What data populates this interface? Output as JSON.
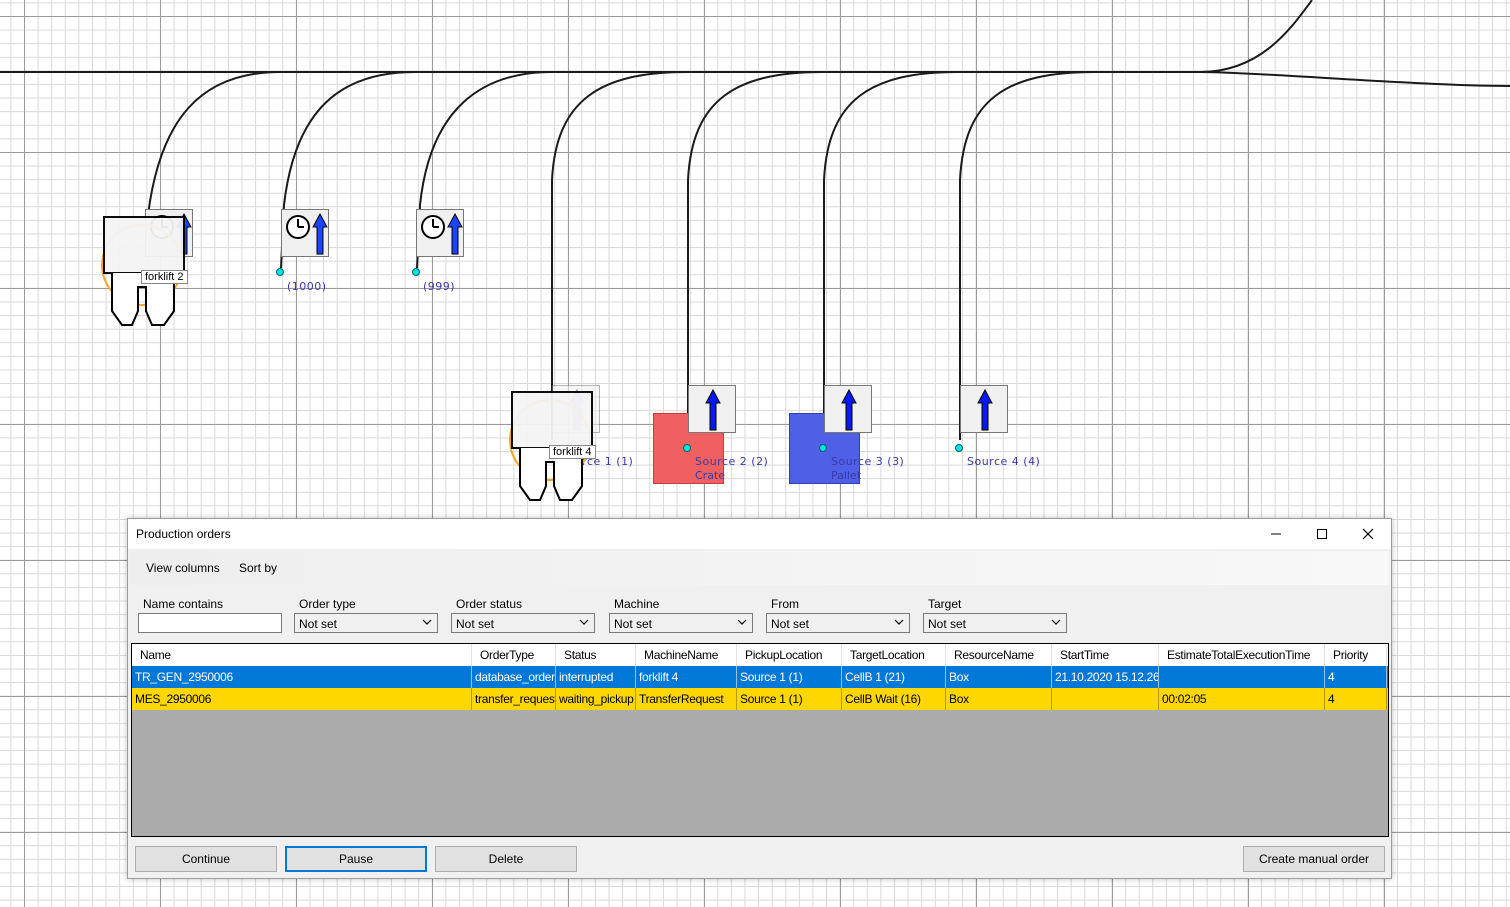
{
  "canvas": {
    "stations": [
      {
        "id": "s-clock-1",
        "has_clock": true
      },
      {
        "id": "s-clock-2",
        "has_clock": true,
        "label": "(1000)"
      },
      {
        "id": "s-clock-3",
        "has_clock": true,
        "label": "(999)"
      },
      {
        "id": "source-1",
        "has_clock": false,
        "label": "Source 1 (1)"
      },
      {
        "id": "source-2",
        "has_clock": false,
        "label": "Source 2 (2)",
        "sublabel": "Crate",
        "color": "#f06060"
      },
      {
        "id": "source-3",
        "has_clock": false,
        "label": "Source 3 (3)",
        "sublabel": "Pallet",
        "color": "#5060e6"
      },
      {
        "id": "source-4",
        "has_clock": false,
        "label": "Source 4 (4)"
      }
    ],
    "forklifts": [
      {
        "name": "forklift 2"
      },
      {
        "name": "forklift 4"
      }
    ],
    "colors": {
      "arrow": "#1a44ff",
      "connector": "#00e5e5",
      "node_label": "#3a3aa8",
      "forklift_ring": "#f5a623"
    }
  },
  "window": {
    "title": "Production orders",
    "controls": {
      "minimize": "minimize-icon",
      "maximize": "maximize-icon",
      "close": "close-icon"
    },
    "menu": {
      "view_columns": "View columns",
      "sort_by": "Sort by"
    },
    "filters": {
      "name_contains": {
        "label": "Name contains",
        "value": ""
      },
      "order_type": {
        "label": "Order type",
        "value": "Not set"
      },
      "order_status": {
        "label": "Order status",
        "value": "Not set"
      },
      "machine": {
        "label": "Machine",
        "value": "Not set"
      },
      "from": {
        "label": "From",
        "value": "Not set"
      },
      "target": {
        "label": "Target",
        "value": "Not set"
      }
    },
    "table": {
      "columns": [
        "Name",
        "OrderType",
        "Status",
        "MachineName",
        "PickupLocation",
        "TargetLocation",
        "ResourceName",
        "StartTime",
        "EstimateTotalExecutionTime",
        "Priority"
      ],
      "rows": [
        [
          "TR_GEN_2950006",
          "database_order",
          "interrupted",
          "forklift 4",
          "Source 1 (1)",
          "CellB 1 (21)",
          "Box",
          "21.10.2020 15.12.26",
          "",
          "4"
        ],
        [
          "MES_2950006",
          "transfer_request",
          "waiting_pickup",
          "TransferRequest",
          "Source 1 (1)",
          "CellB Wait (16)",
          "Box",
          "",
          "00:02:05",
          "4"
        ]
      ],
      "selected_row_color": "#0078d7",
      "highlight_row_color": "#ffd700"
    },
    "buttons": {
      "continue": "Continue",
      "pause": "Pause",
      "delete": "Delete",
      "create_manual_order": "Create manual order"
    }
  }
}
